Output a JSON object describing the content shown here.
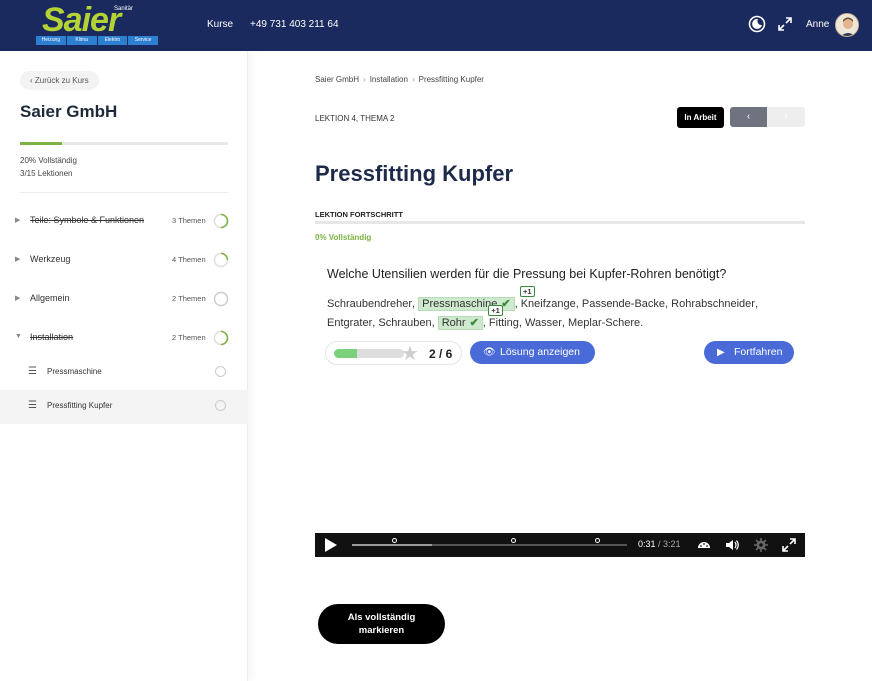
{
  "header": {
    "logo_text": "Saier",
    "logo_tag": "Sanitär",
    "logo_segments": [
      "Heizung",
      "Klima",
      "Elektro",
      "Service"
    ],
    "nav_kurse": "Kurse",
    "phone": "+49 731 403 211 64",
    "user_name": "Anne",
    "icons": [
      "moon-icon",
      "expand-icon"
    ]
  },
  "sidebar": {
    "back_label": "Zurück zu Kurs",
    "course_title": "Saier GmbH",
    "progress_percent": 20,
    "progress_line1": "20% Vollständig",
    "progress_line2": "3/15 Lektionen",
    "modules": [
      {
        "label": "Teile: Symbole & Funktionen",
        "count": "3 Themen",
        "completed": true,
        "expanded": false
      },
      {
        "label": "Werkzeug",
        "count": "4 Themen",
        "completed": false,
        "expanded": false
      },
      {
        "label": "Allgemein",
        "count": "2 Themen",
        "completed": false,
        "expanded": false
      },
      {
        "label": "Installation",
        "count": "2 Themen",
        "completed": true,
        "expanded": true
      }
    ],
    "lessons": [
      {
        "label": "Pressmaschine"
      },
      {
        "label": "Pressfitting Kupfer"
      }
    ]
  },
  "main": {
    "breadcrumb": [
      "Saier GmbH",
      "Installation",
      "Pressfitting Kupfer"
    ],
    "lesson_meta": "LEKTION 4, THEMA 2",
    "status": "In Arbeit",
    "prev_label": "‹",
    "next_label": "›",
    "title": "Pressfitting Kupfer",
    "progress_label": "LEKTION FORTSCHRITT",
    "progress_text": "0% Vollständig",
    "progress_percent": 0,
    "quiz": {
      "question": "Welche Utensilien werden für die Pressung bei Kupfer-Rohren benötigt?",
      "answers": [
        {
          "text": "Schraubendreher",
          "selected": false
        },
        {
          "text": "Pressmaschine",
          "selected": true,
          "badge": "+1"
        },
        {
          "text": "Kneifzange",
          "selected": false
        },
        {
          "text": "Passende-Backe",
          "selected": false
        },
        {
          "text": "Rohrabschneider",
          "selected": false
        },
        {
          "text": "Entgrater",
          "selected": false
        },
        {
          "text": "Schrauben",
          "selected": false
        },
        {
          "text": "Rohr",
          "selected": true,
          "badge": "+1"
        },
        {
          "text": "Fitting",
          "selected": false
        },
        {
          "text": "Wasser",
          "selected": false
        },
        {
          "text": "Meplar-Schere",
          "selected": false
        }
      ],
      "score": "2 / 6",
      "score_fraction": 0.333,
      "show_solution": "Lösung anzeigen",
      "continue": "Fortfahren"
    },
    "video": {
      "current": "0:31",
      "duration": "/ 3:21",
      "progress_fraction": 0.154
    },
    "complete_line1": "Als vollständig",
    "complete_line2": "markieren"
  }
}
